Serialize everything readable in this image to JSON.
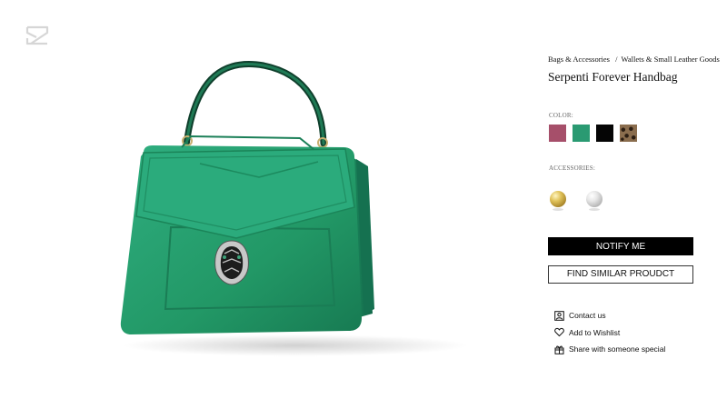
{
  "brand": {
    "logo_icon": "brand-logo-icon"
  },
  "product": {
    "breadcrumb": [
      "Bags & Accessories",
      "Wallets & Small Leather Goods"
    ],
    "breadcrumb_separator": "/",
    "title": "Serpenti Forever Handbag",
    "image_icon": "handbag-image",
    "bag_color": "#2a9a72"
  },
  "color_section": {
    "label": "COLOR:",
    "swatches": [
      {
        "name": "rose",
        "color": "#a64f6a"
      },
      {
        "name": "emerald",
        "color": "#2a9a72"
      },
      {
        "name": "black",
        "color": "#050505"
      },
      {
        "name": "leopard",
        "color": "#6b5440"
      }
    ]
  },
  "accessories_section": {
    "label": "ACCESSORIES:",
    "items": [
      {
        "name": "gold-charm",
        "icon": "gold-ball-icon"
      },
      {
        "name": "silver-charm",
        "icon": "silver-ball-icon"
      }
    ]
  },
  "actions": {
    "notify_label": "NOTIFY ME",
    "similar_label": "FIND SIMILAR PROUDCT"
  },
  "links": {
    "contact": {
      "label": "Contact us",
      "icon": "contact-card-icon"
    },
    "wishlist": {
      "label": "Add to Wishlist",
      "icon": "heart-icon"
    },
    "share": {
      "label": "Share with someone special",
      "icon": "gift-share-icon"
    }
  }
}
